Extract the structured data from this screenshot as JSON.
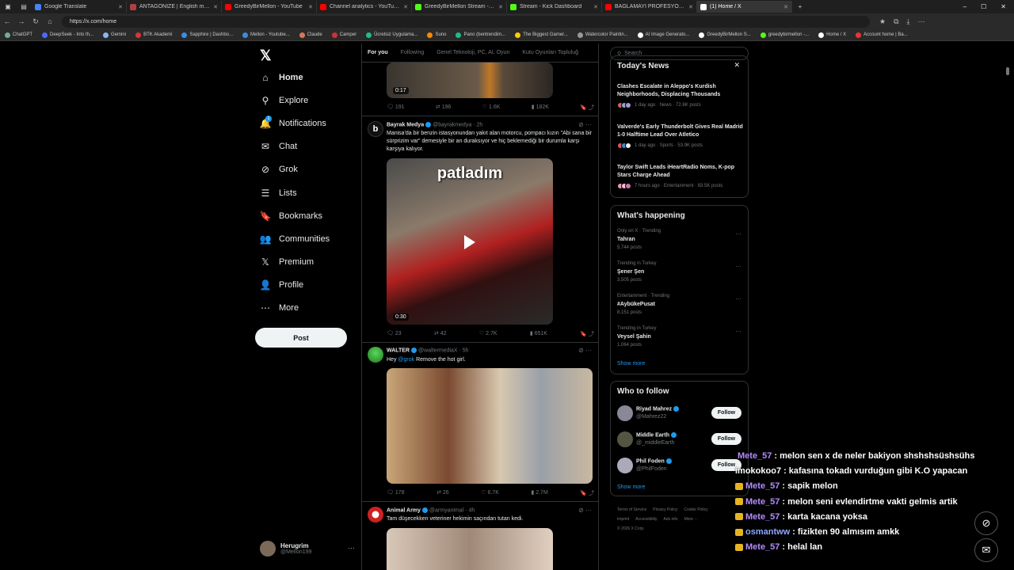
{
  "browser": {
    "tabs": [
      {
        "title": "Google Translate",
        "color": "#4285f4"
      },
      {
        "title": "ANTAGONIZE | English meaning -",
        "color": "#b04040"
      },
      {
        "title": "GreedyBirMellon - YouTube",
        "color": "#ff0000"
      },
      {
        "title": "Channel analytics - YouTube Studi",
        "color": "#ff0000"
      },
      {
        "title": "GreedyBirMellon Stream - Watch",
        "color": "#53fc18"
      },
      {
        "title": "Stream - Kick Dashboard",
        "color": "#53fc18"
      },
      {
        "title": "BAĞLAMAYI PROFESYONEL ÇALM",
        "color": "#ff0000"
      },
      {
        "title": "(1) Home / X",
        "color": "#ffffff"
      }
    ],
    "url": "https://x.com/home",
    "bookmarks": [
      {
        "label": "ChatGPT",
        "color": "#74aa9c"
      },
      {
        "label": "DeepSeek - Into th...",
        "color": "#4d6bfe"
      },
      {
        "label": "Gemini",
        "color": "#8ab4f8"
      },
      {
        "label": "BTK Akademi",
        "color": "#d33"
      },
      {
        "label": "Sapphire | Dashbo...",
        "color": "#3a8dde"
      },
      {
        "label": "Mellon - Youtube...",
        "color": "#3a8dde"
      },
      {
        "label": "Claude",
        "color": "#d97757"
      },
      {
        "label": "Camper",
        "color": "#c33"
      },
      {
        "label": "Ücretsiz Uygulama...",
        "color": "#2b8"
      },
      {
        "label": "Suno",
        "color": "#f80"
      },
      {
        "label": "Pano (bentrendim...",
        "color": "#2b8"
      },
      {
        "label": "The Biggest Gamer...",
        "color": "#fc0"
      },
      {
        "label": "Watercolor Paintin...",
        "color": "#999"
      },
      {
        "label": "AI Image Generato...",
        "color": "#fff"
      },
      {
        "label": "GreedyBirMellon S...",
        "color": "#fff"
      },
      {
        "label": "greedybirmellon -...",
        "color": "#53fc18"
      },
      {
        "label": "Home / X",
        "color": "#fff"
      },
      {
        "label": "Account home | Ba...",
        "color": "#e33"
      }
    ]
  },
  "nav": {
    "items": [
      {
        "label": "Home",
        "icon": "home-icon",
        "glyph": "⌂"
      },
      {
        "label": "Explore",
        "icon": "search-icon",
        "glyph": "⚲"
      },
      {
        "label": "Notifications",
        "icon": "bell-icon",
        "glyph": "🔔"
      },
      {
        "label": "Chat",
        "icon": "mail-icon",
        "glyph": "✉"
      },
      {
        "label": "Grok",
        "icon": "grok-icon",
        "glyph": "⊘"
      },
      {
        "label": "Lists",
        "icon": "list-icon",
        "glyph": "☰"
      },
      {
        "label": "Bookmarks",
        "icon": "bookmark-icon",
        "glyph": "🔖"
      },
      {
        "label": "Communities",
        "icon": "people-icon",
        "glyph": "👥"
      },
      {
        "label": "Premium",
        "icon": "x-logo-icon",
        "glyph": "𝕏"
      },
      {
        "label": "Profile",
        "icon": "person-icon",
        "glyph": "👤"
      },
      {
        "label": "More",
        "icon": "more-circle-icon",
        "glyph": "⋯"
      }
    ],
    "notification_count": "1",
    "post_label": "Post",
    "account": {
      "name": "Herugrim",
      "handle": "@Mellon199"
    }
  },
  "timeline": {
    "tabs": [
      "For you",
      "Following",
      "Genel Teknoloji, PC, AI, Oyun",
      "Kutu Oyunları Topluluğ"
    ],
    "tweet0": {
      "duration": "0:17",
      "replies": "191",
      "reposts": "196",
      "likes": "1.6K",
      "views": "182K"
    },
    "tweet1": {
      "name": "Bayrak Medya",
      "handle": "@bayrakmedya",
      "time": "· 2h",
      "text": "Manisa'da bir benzin istasyonundan yakıt alan motorcu, pompacı kızın \"Abi sana bir sürprizim var\" demesiyle bir an duraksıyor ve hiç beklemediği bir durumla karşı karşıya kalıyor.",
      "overlay": "patladım",
      "duration": "0:30",
      "replies": "23",
      "reposts": "42",
      "likes": "2.7K",
      "views": "651K"
    },
    "tweet2": {
      "name": "WALTER",
      "handle": "@waltermediaX",
      "time": "· 5h",
      "text_pre": "Hey ",
      "mention": "@grok",
      "text_post": " Remove the hot girl.",
      "replies": "178",
      "reposts": "26",
      "likes": "6.7K",
      "views": "2.7M"
    },
    "tweet3": {
      "name": "Animal Army",
      "handle": "@armyanimal",
      "time": "· 4h",
      "text": "Tam düşecekken veteriner hekimin saçından tutan kedi."
    }
  },
  "sidebar": {
    "search_placeholder": "Search",
    "news_title": "Today's News",
    "news": [
      {
        "headline": "Clashes Escalate in Aleppo's Kurdish Neighborhoods, Displacing Thousands",
        "meta": "1 day ago · News · 72.6K posts"
      },
      {
        "headline": "Valverde's Early Thunderbolt Gives Real Madrid 1-0 Halftime Lead Over Atletico",
        "meta": "1 day ago · Sports · 53.9K posts"
      },
      {
        "headline": "Taylor Swift Leads iHeartRadio Noms, K-pop Stars Charge Ahead",
        "meta": "7 hours ago · Entertainment · 83.5K posts"
      }
    ],
    "happening_title": "What's happening",
    "trends": [
      {
        "meta": "Only on X · Trending",
        "name": "Tahran",
        "count": "5,744 posts"
      },
      {
        "meta": "Trending in Turkey",
        "name": "Şener Şen",
        "count": "3,505 posts"
      },
      {
        "meta": "Entertainment · Trending",
        "name": "#AybükePusat",
        "count": "8,151 posts"
      },
      {
        "meta": "Trending in Turkey",
        "name": "Veysel Şahin",
        "count": "1,064 posts"
      }
    ],
    "show_more": "Show more",
    "wtf_title": "Who to follow",
    "follow_label": "Follow",
    "who_to_follow": [
      {
        "name": "Riyad Mahrez",
        "handle": "@Mahrez22"
      },
      {
        "name": "Middle Earth",
        "handle": "@_middleEarth"
      },
      {
        "name": "Phil Foden",
        "handle": "@PhilFoden"
      }
    ],
    "footer": [
      "Terms of Service",
      "Privacy Policy",
      "Cookie Policy",
      "Imprint",
      "Accessibility",
      "Ads info",
      "More ···",
      "© 2026 X Corp."
    ]
  },
  "chat": [
    {
      "user": "Mete_57",
      "msg": "melon sen x de neler bakiyon shshshsüshsühs",
      "badge": true,
      "style": "user"
    },
    {
      "user": "imokokoo7",
      "msg": "kafasına tokadı vurduğun gibi K.O yapacan",
      "badge": false,
      "style": "plain"
    },
    {
      "user": "Mete_57",
      "msg": "sapik melon",
      "badge": true,
      "style": "user"
    },
    {
      "user": "Mete_57",
      "msg": "melon seni evlendirtme vakti gelmis artik",
      "badge": true,
      "style": "user"
    },
    {
      "user": "Mete_57",
      "msg": "karta kacana yoksa",
      "badge": true,
      "style": "user"
    },
    {
      "user": "osmantww",
      "msg": "fizikten 90 almısım amkk",
      "badge": true,
      "style": "user2"
    },
    {
      "user": "Mete_57",
      "msg": "helal lan",
      "badge": true,
      "style": "user"
    }
  ]
}
